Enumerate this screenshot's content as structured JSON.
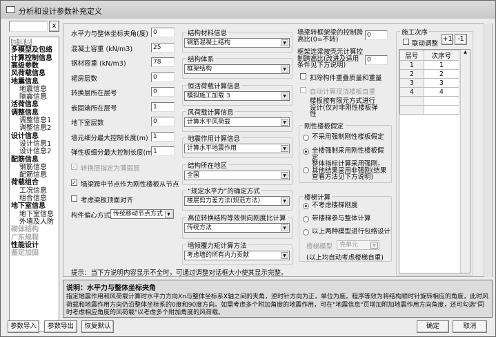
{
  "window": {
    "title": "分析和设计参数补充定义"
  },
  "search": {
    "value": "",
    "clear_label": "x"
  },
  "tree": [
    {
      "label": "总信息",
      "level": 0,
      "selected": true
    },
    {
      "label": "多模型及包络",
      "level": 0
    },
    {
      "label": "计算控制信息",
      "level": 0
    },
    {
      "label": "高级参数",
      "level": 0
    },
    {
      "label": "风荷载信息",
      "level": 0
    },
    {
      "label": "地震信息",
      "level": 0
    },
    {
      "label": "地震信息",
      "level": 1
    },
    {
      "label": "隔震信息",
      "level": 1
    },
    {
      "label": "活荷信息",
      "level": 0
    },
    {
      "label": "调整信息",
      "level": 0
    },
    {
      "label": "调整信息1",
      "level": 1
    },
    {
      "label": "调整信息2",
      "level": 1
    },
    {
      "label": "设计信息",
      "level": 0
    },
    {
      "label": "设计信息1",
      "level": 1
    },
    {
      "label": "设计信息2",
      "level": 1
    },
    {
      "label": "配筋信息",
      "level": 0
    },
    {
      "label": "钢筋信息",
      "level": 1
    },
    {
      "label": "配筋信息",
      "level": 1
    },
    {
      "label": "荷载组合",
      "level": 0
    },
    {
      "label": "工况信息",
      "level": 1
    },
    {
      "label": "组合信息",
      "level": 1
    },
    {
      "label": "地下室信息",
      "level": 0
    },
    {
      "label": "地下室信息",
      "level": 1
    },
    {
      "label": "外墙及人防",
      "level": 1
    },
    {
      "label": "砌体结构",
      "level": 0,
      "disabled": true
    },
    {
      "label": "广东规程",
      "level": 0,
      "disabled": true
    },
    {
      "label": "性能设计",
      "level": 0
    },
    {
      "label": "鉴定加固",
      "level": 0,
      "disabled": true
    }
  ],
  "fields": [
    {
      "label": "水平力与整体坐标夹角(度)",
      "value": "0"
    },
    {
      "label": "混凝土容重  (kN/m3)",
      "value": "25"
    },
    {
      "label": "钢材容重    (kN/m3)",
      "value": "78"
    },
    {
      "label": "裙房层数",
      "value": "0"
    },
    {
      "label": "转换层所在层号",
      "value": "0"
    },
    {
      "label": "嵌固端所在层号",
      "value": "1"
    },
    {
      "label": "地下室层数",
      "value": "0"
    },
    {
      "label": "墙元细分最大控制长度(m)",
      "value": "1"
    },
    {
      "label": "弹性板细分最大控制长度(m)",
      "value": "1"
    }
  ],
  "checks": [
    {
      "label": "转换层指定为薄弱层",
      "checked": true,
      "disabled": true
    },
    {
      "label": "墙梁跨中节点作为刚性楼板从节点",
      "checked": true
    },
    {
      "label": "考虑梁板顶面对齐",
      "checked": false
    }
  ],
  "eccentric": {
    "label": "构件偏心方式",
    "value": "传统移动节点方式"
  },
  "groups": [
    {
      "title": "结构材料信息",
      "value": "钢筋混凝土结构"
    },
    {
      "title": "结构体系",
      "value": "框架结构"
    },
    {
      "title": "恒活荷载计算信息",
      "value": "模拟施工加载  3"
    },
    {
      "title": "风荷载计算信息",
      "value": "计算水平风荷载"
    },
    {
      "title": "地震作用计算信息",
      "value": "计算水平地震作用"
    },
    {
      "title": "结构所在地区",
      "value": "全国"
    },
    {
      "title": "“规定水平力”的确定方式",
      "value": "楼层剪力差方法(规范方法)"
    },
    {
      "title": "高位转换结构等效侧向刚度比计算",
      "value": "传统方法"
    },
    {
      "title": "墙倾覆力矩计算方法",
      "value": "考虑墙的所有内力贡献"
    }
  ],
  "right": {
    "wall_beam_label": "墙梁转框架梁的控制跨高比(0=不转)",
    "wall_beam_value": "0",
    "frame_link_label": "框架连梁按壳元计算控制跨高比(改进及适用条件见下方说明)",
    "frame_link_value": "0",
    "deduct_label": "扣除构件重叠质量和重量",
    "auto_slab_label": "自动计算现浇楼板自重",
    "fem_slab_label": "楼板按有限元方式进行设计(仅对非刚性楼板弹性",
    "rigid": {
      "title": "刚性楼板假定",
      "options": [
        "不采用强制刚性楼板假定",
        "全楼强制采用刚性楼板假定",
        "整体指标计算采用强刚，其他结果采用非强刚(结果查看方法见下方说明)"
      ],
      "selected": 1
    },
    "stair": {
      "title": "楼梯计算",
      "options": [
        "不考虑楼梯刚度",
        "带楼梯参与整体计算",
        "以上两种模型进行包络设计"
      ],
      "selected": 0,
      "model_label": "楼梯模型",
      "model_value": "壳单元",
      "note": "(以上均自动考虑楼梯自重)"
    }
  },
  "sequence": {
    "title": "施工次序",
    "link_label": "联动调整",
    "plus_label": "+1",
    "minus_label": "-1",
    "headers": [
      "层号",
      "次序号"
    ],
    "rows": [
      [
        "1",
        "1"
      ],
      [
        "2",
        "2"
      ],
      [
        "3",
        "3"
      ],
      [
        "4",
        "4"
      ]
    ]
  },
  "hint": "提示：当下方说明内容显示不全时，可通过调整对话框大小使其显示完整。",
  "description": {
    "title": "说明：水平力与整体坐标夹角",
    "text": "指定地震作用和风荷载计算时水平力方向Xn与整体坐标系X轴之间的夹角，逆时针方向为正，单位为度。程序等效为将结构顺时针旋转相应的角度，此时风荷载和地震作用方向仍沿整体坐标系的0度和90度方向。如需考虑多个附加角度的地震作用，可在\"地震信息\"页增加附加地震作用方向角度，还可勾选\"同时考虑相应角度的风荷载\"以考虑多个附加角度的风荷载。"
  },
  "buttons": {
    "import": "参数导入",
    "export": "参数导出",
    "reset": "恢复默认",
    "ok": "确定",
    "cancel": "取消"
  }
}
